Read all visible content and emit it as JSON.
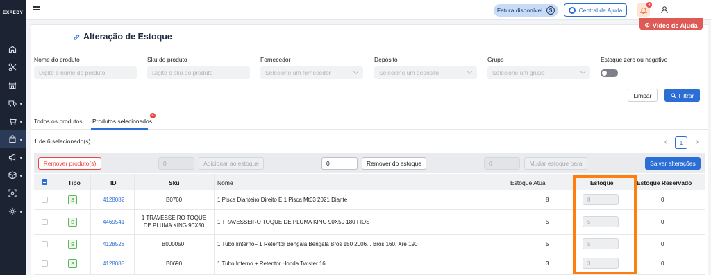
{
  "app": {
    "logo": "EXPEDY"
  },
  "sidebar": {
    "items": [
      {
        "icon": "home-icon",
        "has_arrow": false
      },
      {
        "icon": "scissors-icon",
        "has_arrow": false
      },
      {
        "icon": "store-icon",
        "has_arrow": false
      },
      {
        "icon": "truck-icon",
        "has_arrow": true
      },
      {
        "icon": "cart-icon",
        "has_arrow": true
      },
      {
        "icon": "bag-icon",
        "has_arrow": true,
        "active": true
      },
      {
        "icon": "megaphone-icon",
        "has_arrow": true
      },
      {
        "icon": "box-icon",
        "has_arrow": true
      },
      {
        "icon": "scan-icon",
        "has_arrow": false
      },
      {
        "icon": "gear-icon",
        "has_arrow": true
      }
    ]
  },
  "topbar": {
    "fatura_label": "Fatura disponível",
    "fatura_symbol": "$",
    "help_label": "Central de Ajuda",
    "notifications_count": "4"
  },
  "page": {
    "video_button": "Vídeo de Ajuda",
    "title": "Alteração de Estoque"
  },
  "filters": {
    "nome": {
      "label": "Nome do produto",
      "placeholder": "Digite o nome do produto"
    },
    "sku": {
      "label": "Sku do produto",
      "placeholder": "Digite o sku do produto"
    },
    "fornecedor": {
      "label": "Fornecedor",
      "placeholder": "Selecione um fornecedor"
    },
    "deposito": {
      "label": "Depósito",
      "placeholder": "Selecione um depósito"
    },
    "grupo": {
      "label": "Grupo",
      "placeholder": "Selecione um grupo"
    },
    "estoque_zero": {
      "label": "Estoque zero ou negativo"
    },
    "limpar": "Limpar",
    "filtrar": "Filtrar"
  },
  "tabs": {
    "all": "Todos os produtos",
    "selected": "Produtos selecionados",
    "selected_badge": "6"
  },
  "selection": {
    "count_text": "1 de 6 selecionado(s)",
    "page": "1"
  },
  "toolbar": {
    "remove_products": "Remover produto(s)",
    "add_value": "0",
    "add_label": "Adicionar ao estoque",
    "remove_value": "0",
    "remove_label": "Remover do estoque",
    "change_value": "0",
    "change_label": "Mudar estoque para",
    "save": "Salvar alterações"
  },
  "table": {
    "headers": {
      "tipo": "Tipo",
      "id": "ID",
      "sku": "Sku",
      "nome": "Nome",
      "estoque_atual": "Estoque Atual",
      "estoque": "Estoque",
      "estoque_reservado": "Estoque Reservado"
    },
    "rows": [
      {
        "tipo": "S",
        "id": "4128082",
        "sku": "B0760",
        "nome": "1 Pisca Dianteiro Direito E 1 Pisca Mt03 2021 Diante",
        "estoque_atual": "8",
        "estoque": "8",
        "reservado": "0"
      },
      {
        "tipo": "S",
        "id": "4469541",
        "sku": "1 TRAVESSEIRO TOQUE DE PLUMA KING 90X50",
        "nome": "1 TRAVESSEIRO TOQUE DE PLUMA KING 90X50 180 FIOS",
        "estoque_atual": "5",
        "estoque": "5",
        "reservado": "0"
      },
      {
        "tipo": "S",
        "id": "4128528",
        "sku": "B000050",
        "nome": "1 Tubo Iinterno+ 1 Retentor Bengala Bengala Bros 150 2006... Bros 160, Xre 190",
        "estoque_atual": "5",
        "estoque": "5",
        "reservado": "0"
      },
      {
        "tipo": "S",
        "id": "4128085",
        "sku": "B0690",
        "nome": "1 Tubo Interno + Retentor Honda Twister 16..",
        "estoque_atual": "3",
        "estoque": "3",
        "reservado": "0"
      }
    ]
  }
}
